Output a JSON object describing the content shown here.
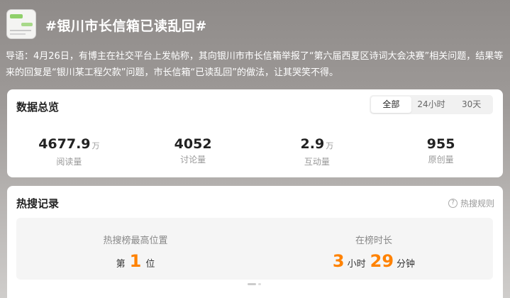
{
  "topic": {
    "title": "#银川市长信箱已读乱回#",
    "intro": "导语：4月26日，有博主在社交平台上发帖称，其向银川市市长信箱举报了“第六届西夏区诗词大会决赛”相关问题，结果等来的回复是“银川某工程欠款”问题，市长信箱“已读乱回”的做法，让其哭笑不得。"
  },
  "overview": {
    "title": "数据总览",
    "filters": [
      "全部",
      "24小时",
      "30天"
    ],
    "stats": [
      {
        "value": "4677.9",
        "unit": "万",
        "label": "阅读量"
      },
      {
        "value": "4052",
        "unit": "",
        "label": "讨论量"
      },
      {
        "value": "2.9",
        "unit": "万",
        "label": "互动量"
      },
      {
        "value": "955",
        "unit": "",
        "label": "原创量"
      }
    ]
  },
  "hot": {
    "title": "热搜记录",
    "rules_label": "热搜规则",
    "peak": {
      "label": "热搜榜最高位置",
      "prefix": "第",
      "value": "1",
      "suffix": "位"
    },
    "duration": {
      "label": "在榜时长",
      "hours": "3",
      "hours_unit": "小时",
      "minutes": "29",
      "minutes_unit": "分钟"
    }
  }
}
